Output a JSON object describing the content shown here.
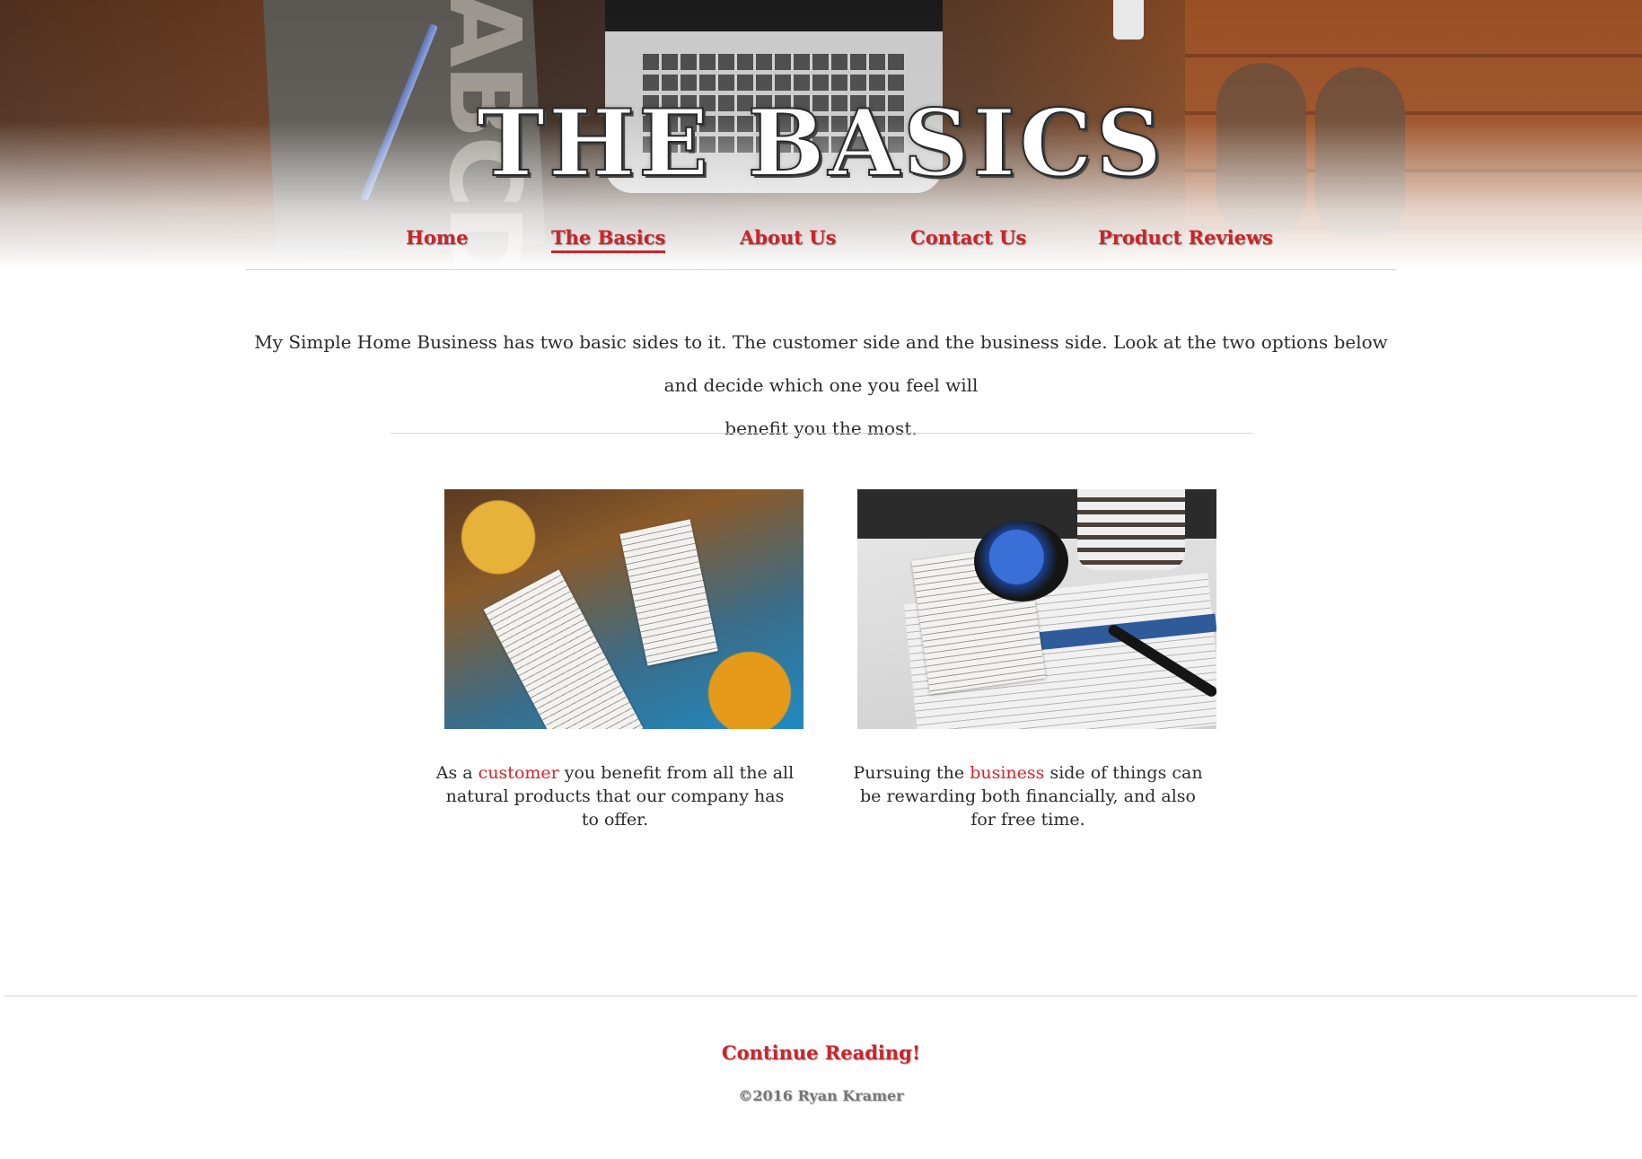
{
  "header": {
    "title": "THE BASICS"
  },
  "nav": {
    "items": [
      {
        "label": "Home",
        "active": false
      },
      {
        "label": "The Basics",
        "active": true
      },
      {
        "label": "About Us",
        "active": false
      },
      {
        "label": "Contact Us",
        "active": false
      },
      {
        "label": "Product Reviews",
        "active": false
      }
    ]
  },
  "main": {
    "intro_line1": "My Simple Home Business has two basic sides to it. The customer side and the business side. Look at the two options below and decide which one you feel will",
    "intro_line2": "benefit you the most.",
    "cards": [
      {
        "text_before": "As a ",
        "highlight": "customer",
        "text_after": " you benefit from all the all natural products that our company has to offer."
      },
      {
        "text_before": "Pursuing the ",
        "highlight": "business",
        "text_after": " side of things can be rewarding both financially, and also for free time."
      }
    ]
  },
  "footer": {
    "continue_label": "Continue Reading!",
    "copyright": "©2016 Ryan Kramer"
  },
  "colors": {
    "accent": "#c9252b",
    "text": "#2b2b2b",
    "rule": "#cfd3d8"
  }
}
